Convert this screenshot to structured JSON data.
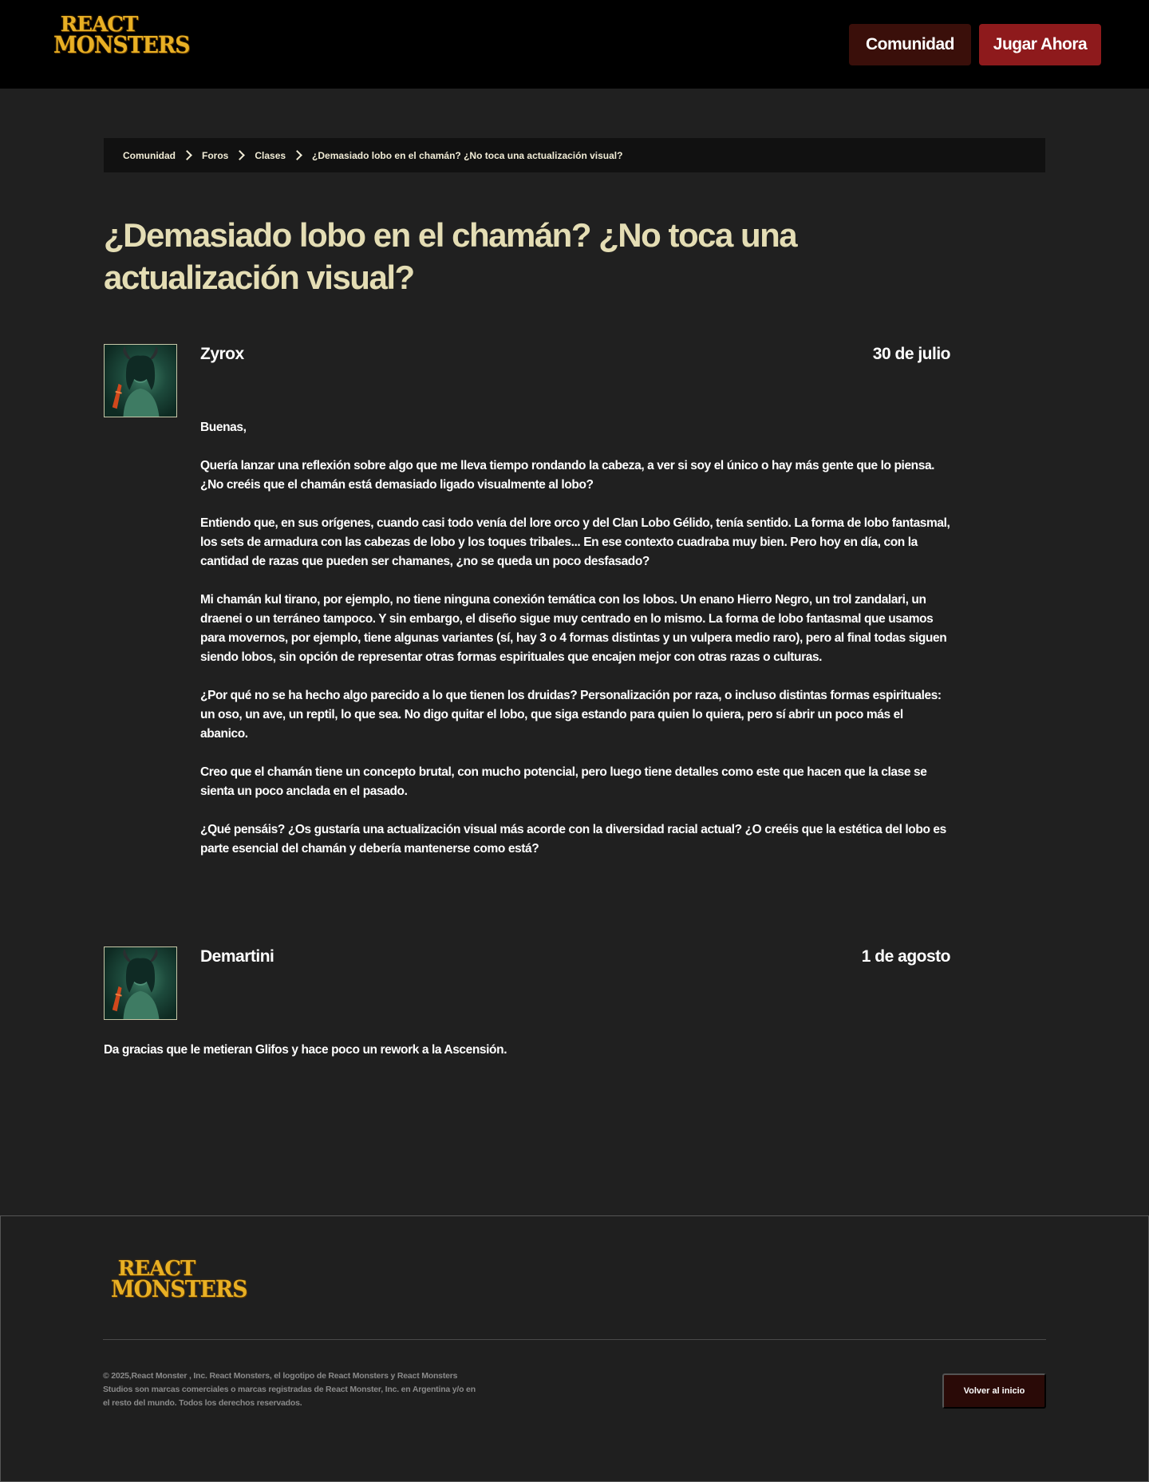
{
  "header": {
    "logo_line1": "REACT",
    "logo_line2": "MONSTERS",
    "community_button": "Comunidad",
    "play_button": "Jugar Ahora"
  },
  "breadcrumb": [
    "Comunidad",
    "Foros",
    "Clases",
    "¿Demasiado lobo en el chamán? ¿No toca una actualización visual?"
  ],
  "page_title": "¿Demasiado lobo en el chamán? ¿No toca una actualización visual?",
  "posts": [
    {
      "author": "Zyrox",
      "date": "30 de julio",
      "paragraphs": [
        "Buenas,",
        "Quería lanzar una reflexión sobre algo que me lleva tiempo rondando la cabeza, a ver si soy el único o hay más gente que lo piensa. ¿No creéis que el chamán está demasiado ligado visualmente al lobo?",
        "Entiendo que, en sus orígenes, cuando casi todo venía del lore orco y del Clan Lobo Gélido, tenía sentido. La forma de lobo fantasmal, los sets de armadura con las cabezas de lobo y los toques tribales... En ese contexto cuadraba muy bien. Pero hoy en día, con la cantidad de razas que pueden ser chamanes, ¿no se queda un poco desfasado?",
        "Mi chamán kul tirano, por ejemplo, no tiene ninguna conexión temática con los lobos. Un enano Hierro Negro, un trol zandalari, un draenei o un terráneo tampoco. Y sin embargo, el diseño sigue muy centrado en lo mismo. La forma de lobo fantasmal que usamos para movernos, por ejemplo, tiene algunas variantes (sí, hay 3 o 4 formas distintas y un vulpera medio raro), pero al final todas siguen siendo lobos, sin opción de representar otras formas espirituales que encajen mejor con otras razas o culturas.",
        "¿Por qué no se ha hecho algo parecido a lo que tienen los druidas? Personalización por raza, o incluso distintas formas espirituales: un oso, un ave, un reptil, lo que sea. No digo quitar el lobo, que siga estando para quien lo quiera, pero sí abrir un poco más el abanico.",
        "Creo que el chamán tiene un concepto brutal, con mucho potencial, pero luego tiene detalles como este que hacen que la clase se sienta un poco anclada en el pasado.",
        "¿Qué pensáis? ¿Os gustaría una actualización visual más acorde con la diversidad racial actual? ¿O creéis que la estética del lobo es parte esencial del chamán y debería mantenerse como está?"
      ]
    },
    {
      "author": "Demartini",
      "date": "1 de agosto",
      "paragraphs": [
        "Da gracias que le metieran Glifos y hace poco un rework a la Ascensión."
      ]
    }
  ],
  "footer": {
    "logo_line1": "REACT",
    "logo_line2": "MONSTERS",
    "legal": "© 2025,React Monster , Inc. React Monsters, el logotipo de React Monsters y React Monsters Studios son marcas comerciales o marcas registradas de React Monster, Inc. en Argentina y/o en el resto del mundo. Todos los derechos reservados.",
    "back_button": "Volver al inicio"
  },
  "colors": {
    "header_bg": "#000000",
    "page_bg": "#202020",
    "title": "#e4ddb4",
    "logo_gold": "#e8b024",
    "community_button": "#3a0f0a",
    "play_button": "#8e1a1c"
  },
  "icons": {
    "breadcrumb_separator": "chevron-right-icon",
    "avatar": "demon-avatar"
  }
}
